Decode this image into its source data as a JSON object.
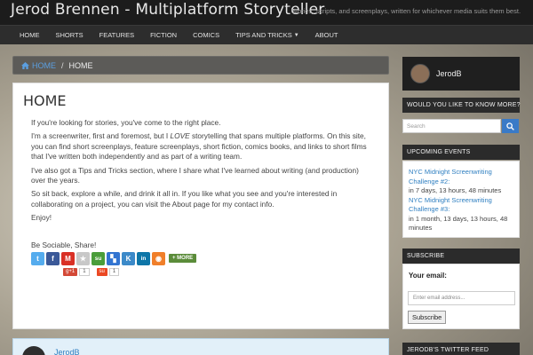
{
  "header": {
    "site_title": "Jerod Brennen - Multiplatform Storyteller",
    "tagline": "Stories, scripts, and screenplays, written for whichever media suits them best."
  },
  "nav": {
    "items": [
      {
        "label": "HOME"
      },
      {
        "label": "SHORTS"
      },
      {
        "label": "FEATURES"
      },
      {
        "label": "FICTION"
      },
      {
        "label": "COMICS"
      },
      {
        "label": "TIPS AND TRICKS",
        "has_dropdown": true
      },
      {
        "label": "ABOUT"
      }
    ],
    "dropdown_icon": "caret-down-icon"
  },
  "breadcrumb": {
    "home_icon": "home-icon",
    "home_label": "HOME",
    "separator": "/",
    "current": "HOME"
  },
  "main": {
    "title": "HOME",
    "p1": "If you're looking for stories, you've come to the right place.",
    "p2_before": "I'm a screenwriter, first and foremost, but I ",
    "p2_em": "LOVE",
    "p2_after": " storytelling that spans multiple platforms. On this site, you can find short screenplays, feature screenplays, short fiction, comics books, and links to short films that I've written both independently and as part of a writing team.",
    "p3": "I've also got a Tips and Tricks section, where I share what I've learned about writing (and production) over the years.",
    "p4": "So sit back, explore a while, and drink it all in. If you like what you see and you're interested in collaborating on a project, you can visit the About page for my contact info.",
    "p5": "Enjoy!",
    "share_label": "Be Sociable, Share!",
    "share_buttons": [
      {
        "name": "twitter-icon",
        "glyph": "t",
        "color": "#55acee"
      },
      {
        "name": "facebook-icon",
        "glyph": "f",
        "color": "#3b5998"
      },
      {
        "name": "gmail-icon",
        "glyph": "M",
        "color": "#d93025"
      },
      {
        "name": "favorites-star-icon",
        "glyph": "★",
        "color": "#c8c8c8"
      },
      {
        "name": "stumbleupon-icon",
        "glyph": "su",
        "color": "#4a9d3a"
      },
      {
        "name": "delicious-icon",
        "glyph": "▚",
        "color": "#3274d1"
      },
      {
        "name": "kindle-icon",
        "glyph": "K",
        "color": "#3c8ac9"
      },
      {
        "name": "linkedin-icon",
        "glyph": "in",
        "color": "#0e76a8"
      },
      {
        "name": "share-circle-icon",
        "glyph": "◉",
        "color": "#f07f2a"
      }
    ],
    "more_label": "MORE",
    "gplus_label": "g+1",
    "gplus_count": "1",
    "stumble_count": "1",
    "author_name": "JerodB"
  },
  "sidebar": {
    "profile_name": "JerodB",
    "know_more_heading": "WOULD YOU LIKE TO KNOW MORE?",
    "search_placeholder": "Search",
    "search_icon": "search-icon",
    "events_heading": "UPCOMING EVENTS",
    "events": [
      {
        "title": "NYC Midnight Screenwriting Challenge #2:",
        "time": "in 7 days, 13 hours, 48 minutes"
      },
      {
        "title": "NYC Midnight Screenwriting Challenge #3:",
        "time": "in 1 month, 13 days, 13 hours, 48 minutes"
      }
    ],
    "subscribe_heading": "SUBSCRIBE",
    "subscribe_label": "Your email:",
    "email_placeholder": "Enter email address...",
    "subscribe_button": "Subscribe",
    "twitter_heading": "JERODB'S TWITTER FEED"
  }
}
